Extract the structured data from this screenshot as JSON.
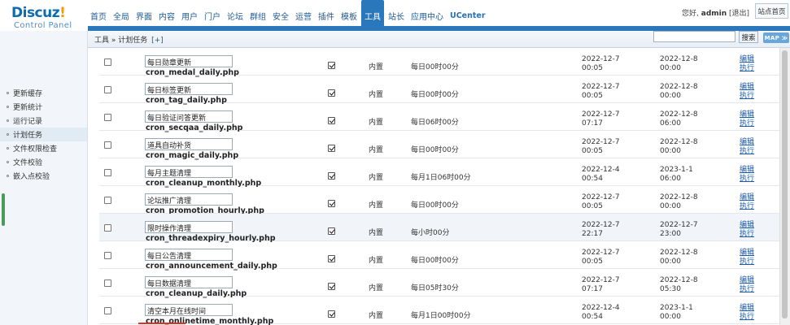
{
  "logo": {
    "main": "Discuz",
    "bang": "!",
    "sub": "Control Panel"
  },
  "nav": [
    {
      "label": "首页"
    },
    {
      "label": "全局"
    },
    {
      "label": "界面"
    },
    {
      "label": "内容"
    },
    {
      "label": "用户"
    },
    {
      "label": "门户"
    },
    {
      "label": "论坛"
    },
    {
      "label": "群组"
    },
    {
      "label": "安全"
    },
    {
      "label": "运营"
    },
    {
      "label": "插件"
    },
    {
      "label": "模板"
    },
    {
      "label": "工具",
      "active": true
    },
    {
      "label": "站长"
    },
    {
      "label": "应用中心"
    },
    {
      "label": "UCenter"
    }
  ],
  "user": {
    "greeting": "您好,",
    "name": "admin",
    "logout": "[退出]",
    "home_button": "站点首页"
  },
  "breadcrumb": {
    "path": "工具 » 计划任务",
    "add": "[+]"
  },
  "search": {
    "placeholder": "",
    "button": "搜索",
    "map": "MAP ≫"
  },
  "sidebar": [
    {
      "label": "更新缓存"
    },
    {
      "label": "更新统计"
    },
    {
      "label": "运行记录"
    },
    {
      "label": "计划任务",
      "active": true
    },
    {
      "label": "文件权限检查"
    },
    {
      "label": "文件校验"
    },
    {
      "label": "嵌入点校验"
    }
  ],
  "tasks": [
    {
      "name": "每日勋章更新",
      "file": "cron_medal_daily.php",
      "available": true,
      "type": "内置",
      "schedule": "每日00时00分",
      "last_date": "2022-12-7",
      "last_time": "00:05",
      "next_date": "2022-12-8",
      "next_time": "00:00",
      "edit": "编辑",
      "run": "执行"
    },
    {
      "name": "每日标签更新",
      "file": "cron_tag_daily.php",
      "available": true,
      "type": "内置",
      "schedule": "每日00时00分",
      "last_date": "2022-12-7",
      "last_time": "00:05",
      "next_date": "2022-12-8",
      "next_time": "00:00",
      "edit": "编辑",
      "run": "执行"
    },
    {
      "name": "每日验证问答更新",
      "file": "cron_secqaa_daily.php",
      "available": true,
      "type": "内置",
      "schedule": "每日06时00分",
      "last_date": "2022-12-7",
      "last_time": "07:17",
      "next_date": "2022-12-8",
      "next_time": "06:00",
      "edit": "编辑",
      "run": "执行"
    },
    {
      "name": "道具自动补货",
      "file": "cron_magic_daily.php",
      "available": true,
      "type": "内置",
      "schedule": "每日00时00分",
      "last_date": "2022-12-7",
      "last_time": "00:05",
      "next_date": "2022-12-8",
      "next_time": "00:00",
      "edit": "编辑",
      "run": "执行"
    },
    {
      "name": "每月主题清理",
      "file": "cron_cleanup_monthly.php",
      "available": true,
      "type": "内置",
      "schedule": "每月1日06时00分",
      "last_date": "2022-12-4",
      "last_time": "00:54",
      "next_date": "2023-1-1",
      "next_time": "06:00",
      "edit": "编辑",
      "run": "执行"
    },
    {
      "name": "论坛推广清理",
      "file": "cron_promotion_hourly.php",
      "available": true,
      "type": "内置",
      "schedule": "每日00时00分",
      "last_date": "2022-12-7",
      "last_time": "00:05",
      "next_date": "2022-12-8",
      "next_time": "00:00",
      "edit": "编辑",
      "run": "执行"
    },
    {
      "name": "限时操作清理",
      "file": "cron_threadexpiry_hourly.php",
      "available": true,
      "type": "内置",
      "schedule": "每小时00分",
      "last_date": "2022-12-7",
      "last_time": "22:17",
      "next_date": "2022-12-7",
      "next_time": "23:00",
      "edit": "编辑",
      "run": "执行",
      "hover": true
    },
    {
      "name": "每日公告清理",
      "file": "cron_announcement_daily.php",
      "available": true,
      "type": "内置",
      "schedule": "每日00时00分",
      "last_date": "2022-12-7",
      "last_time": "00:05",
      "next_date": "2022-12-8",
      "next_time": "00:00",
      "edit": "编辑",
      "run": "执行"
    },
    {
      "name": "每日数据清理",
      "file": "cron_cleanup_daily.php",
      "available": true,
      "type": "内置",
      "schedule": "每日05时30分",
      "last_date": "2022-12-7",
      "last_time": "07:17",
      "next_date": "2022-12-8",
      "next_time": "05:30",
      "edit": "编辑",
      "run": "执行"
    },
    {
      "name": "清空本月在线时间",
      "file": "cron_onlinetime_monthly.php",
      "available": true,
      "type": "内置",
      "schedule": "每月1日00时00分",
      "last_date": "2022-12-4",
      "last_time": "00:54",
      "next_date": "2023-1-1",
      "next_time": "00:00",
      "edit": "编辑",
      "run": "执行"
    }
  ],
  "colors": {
    "accent": "#2a77bc",
    "link": "#1c5aa8",
    "logo": "#0d6bb0",
    "logo_bang": "#f39a00"
  }
}
